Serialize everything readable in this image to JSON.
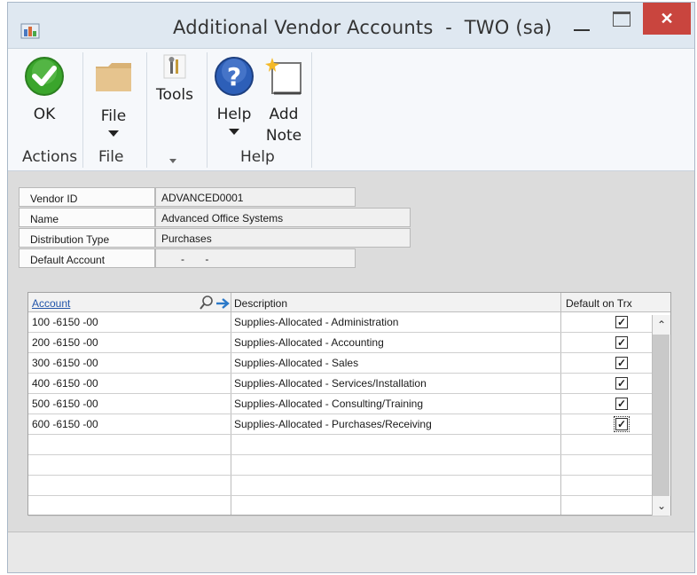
{
  "window": {
    "title": "Additional Vendor Accounts  -  TWO (sa)",
    "close_glyph": "✕"
  },
  "ribbon": {
    "buttons": {
      "ok": "OK",
      "file": "File",
      "tools": "Tools",
      "help": "Help",
      "add_note_line1": "Add",
      "add_note_line2": "Note"
    },
    "groups": {
      "actions": "Actions",
      "file": "File",
      "help": "Help"
    }
  },
  "header": {
    "vendor_id_label": "Vendor ID",
    "vendor_id_value": "ADVANCED0001",
    "name_label": "Name",
    "name_value": "Advanced Office Systems",
    "distribution_type_label": "Distribution Type",
    "distribution_type_value": "Purchases",
    "default_account_label": "Default Account",
    "default_account_value": "-       -"
  },
  "grid": {
    "columns": {
      "account": "Account",
      "description": "Description",
      "default_on_trx": "Default on Trx"
    },
    "rows": [
      {
        "account": "100 -6150 -00",
        "description": "Supplies-Allocated - Administration",
        "default": true
      },
      {
        "account": "200 -6150 -00",
        "description": "Supplies-Allocated - Accounting",
        "default": true
      },
      {
        "account": "300 -6150 -00",
        "description": "Supplies-Allocated - Sales",
        "default": true
      },
      {
        "account": "400 -6150 -00",
        "description": "Supplies-Allocated - Services/Installation",
        "default": true
      },
      {
        "account": "500 -6150 -00",
        "description": "Supplies-Allocated - Consulting/Training",
        "default": true
      },
      {
        "account": "600 -6150 -00",
        "description": "Supplies-Allocated - Purchases/Receiving",
        "default": true
      }
    ],
    "check_glyph": "✓",
    "scroll_up_glyph": "⌃",
    "scroll_down_glyph": "⌄"
  },
  "colors": {
    "accent_link": "#2255aa",
    "close_button": "#c9453e",
    "ok_green": "#3aa52c",
    "help_blue": "#2d5fb8",
    "folder": "#d9b275"
  }
}
